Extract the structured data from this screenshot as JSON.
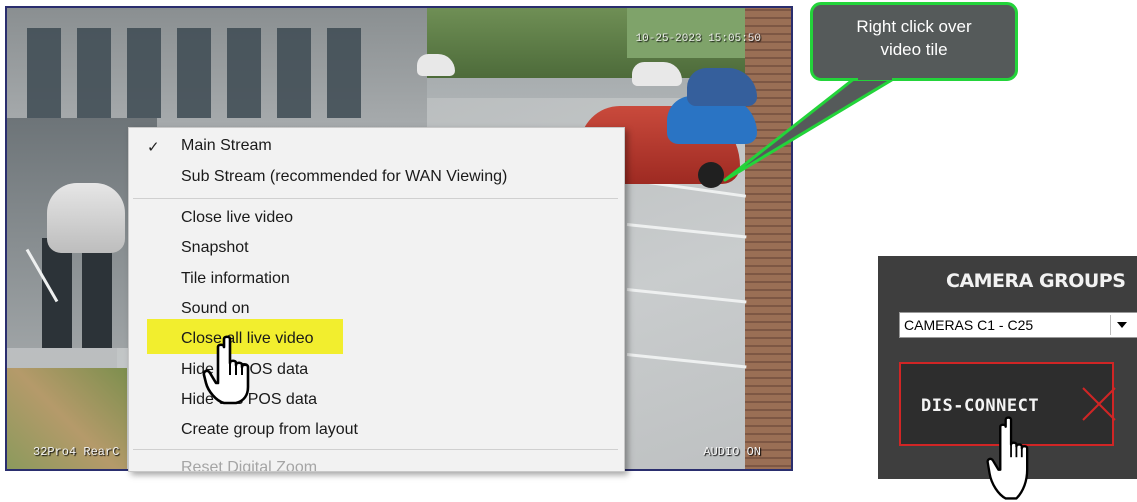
{
  "video": {
    "timestamp": "10-25-2023 15:05:50",
    "camera_label": "32Pro4 RearC",
    "audio_status": "AUDIO ON"
  },
  "context_menu": {
    "items": [
      {
        "label": "Main Stream",
        "checked": true
      },
      {
        "label": "Sub Stream (recommended for WAN Viewing)"
      },
      {
        "label": "Close live video"
      },
      {
        "label": "Snapshot"
      },
      {
        "label": "Tile information"
      },
      {
        "label": "Sound on"
      },
      {
        "label": "Close all live video",
        "highlighted": true
      },
      {
        "label": "Hide all POS data"
      },
      {
        "label": "Hide this POS data"
      },
      {
        "label": "Create group from layout"
      },
      {
        "label": "Reset Digital Zoom",
        "disabled": true
      }
    ],
    "highlight_color": "#f2ee2e"
  },
  "callout": {
    "text_line1": "Right click over",
    "text_line2": "video tile",
    "border_color": "#23d43a"
  },
  "panel": {
    "title": "CAMERA GROUPS",
    "select_value": "CAMERAS C1 - C25",
    "disconnect_label": "DIS-CONNECT",
    "disconnect_color": "#d02525"
  },
  "icons": [
    "checkmark-icon",
    "hand-pointer-icon",
    "close-x-icon",
    "dropdown-arrow-icon"
  ]
}
